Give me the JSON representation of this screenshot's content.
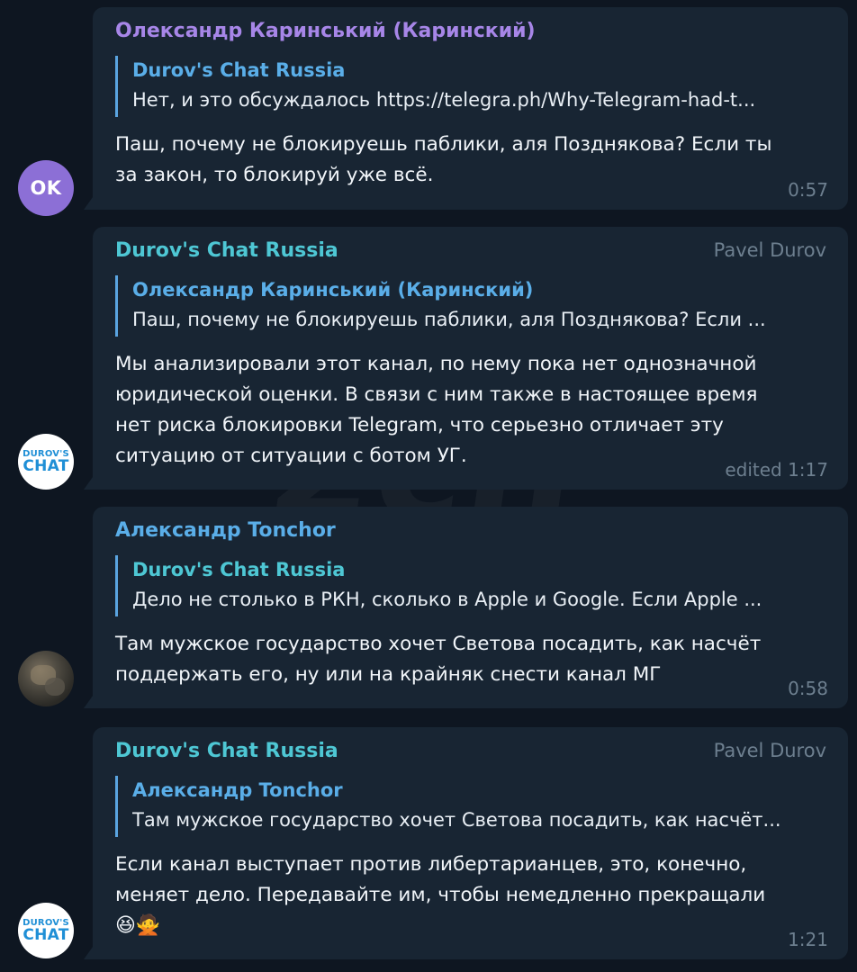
{
  "colors": {
    "background": "#0e1621",
    "bubble": "#182533",
    "name_purple": "#a786e8",
    "name_teal": "#4ec7d4",
    "name_blue": "#5aaee8",
    "reply_bar": "#5aa4e0",
    "meta_gray": "#6d7f8f"
  },
  "messages": [
    {
      "sender": "Олександр Каринський (Каринский)",
      "avatar_initials": "OK",
      "reply_name": "Durov's Chat Russia",
      "reply_text": "Нет, и это обсуждалось https://telegra.ph/Why-Telegram-had-t...",
      "body": "Паш, почему не блокируешь паблики, аля Позднякова? Если ты за закон, то блокируй уже всё.",
      "time": "0:57"
    },
    {
      "sender": "Durov's Chat Russia",
      "author": "Pavel Durov",
      "avatar_line1": "DUROV'S",
      "avatar_line2": "CHAT",
      "reply_name": "Олександр Каринський (Каринский)",
      "reply_text": "Паш, почему не блокируешь паблики, аля Позднякова? Если ...",
      "body": "Мы анализировали этот канал, по нему пока нет однозначной юридической оценки. В связи с ним также в настоящее время нет риска блокировки Telegram, что серьезно отличает эту ситуацию от ситуации с ботом УГ.",
      "time": "edited 1:17"
    },
    {
      "sender": "Александр Tonchor",
      "reply_name": "Durov's Chat Russia",
      "reply_text": "Дело не столько в РКН, сколько в Apple и Google. Если Apple ...",
      "body": "Там мужское государство хочет Светова посадить, как насчёт поддержать его, ну или на крайняк снести канал МГ",
      "time": "0:58"
    },
    {
      "sender": "Durov's Chat Russia",
      "author": "Pavel Durov",
      "avatar_line1": "DUROV'S",
      "avatar_line2": "CHAT",
      "reply_name": "Александр Tonchor",
      "reply_text": "Там мужское государство хочет Светова посадить, как насчёт...",
      "body": "Если канал выступает против либертарианцев, это, конечно, меняет дело. Передавайте им, чтобы немедленно прекращали",
      "emojis": "😆🙅",
      "time": "1:21"
    }
  ]
}
